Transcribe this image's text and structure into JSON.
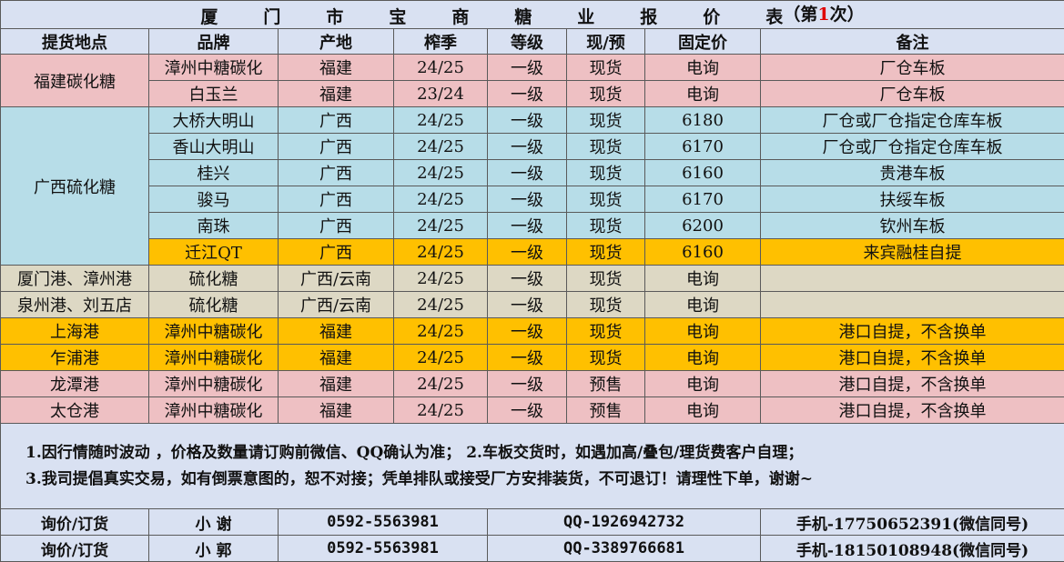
{
  "title": {
    "chars": [
      "厦",
      "门",
      "市",
      "宝",
      "商",
      "糖",
      "业",
      "报",
      "价",
      "表"
    ],
    "suffix_open": "（第",
    "suffix_num": "1",
    "suffix_close": "次）"
  },
  "headers": [
    "提货地点",
    "品牌",
    "产地",
    "榨季",
    "等级",
    "现/预",
    "固定价",
    "备注"
  ],
  "groups": {
    "fujian": "福建碳化糖",
    "guangxi": "广西硫化糖"
  },
  "rows": [
    {
      "location": "",
      "brand": "漳州中糖碳化",
      "origin": "福建",
      "season": "24/25",
      "grade": "一级",
      "status": "现货",
      "price": "电询",
      "note": "厂仓车板"
    },
    {
      "location": "",
      "brand": "白玉兰",
      "origin": "福建",
      "season": "23/24",
      "grade": "一级",
      "status": "现货",
      "price": "电询",
      "note": "厂仓车板"
    },
    {
      "location": "",
      "brand": "大桥大明山",
      "origin": "广西",
      "season": "24/25",
      "grade": "一级",
      "status": "现货",
      "price": "6180",
      "note": "厂仓或厂仓指定仓库车板"
    },
    {
      "location": "",
      "brand": "香山大明山",
      "origin": "广西",
      "season": "24/25",
      "grade": "一级",
      "status": "现货",
      "price": "6170",
      "note": "厂仓或厂仓指定仓库车板"
    },
    {
      "location": "",
      "brand": "桂兴",
      "origin": "广西",
      "season": "24/25",
      "grade": "一级",
      "status": "现货",
      "price": "6160",
      "note": "贵港车板"
    },
    {
      "location": "",
      "brand": "骏马",
      "origin": "广西",
      "season": "24/25",
      "grade": "一级",
      "status": "现货",
      "price": "6170",
      "note": "扶绥车板"
    },
    {
      "location": "",
      "brand": "南珠",
      "origin": "广西",
      "season": "24/25",
      "grade": "一级",
      "status": "现货",
      "price": "6200",
      "note": "钦州车板"
    },
    {
      "location": "",
      "brand": "迁江QT",
      "origin": "广西",
      "season": "24/25",
      "grade": "一级",
      "status": "现货",
      "price": "6160",
      "note": "来宾融桂自提"
    },
    {
      "location": "厦门港、漳州港",
      "brand": "硫化糖",
      "origin": "广西/云南",
      "season": "24/25",
      "grade": "一级",
      "status": "现货",
      "price": "电询",
      "note": ""
    },
    {
      "location": "泉州港、刘五店",
      "brand": "硫化糖",
      "origin": "广西/云南",
      "season": "24/25",
      "grade": "一级",
      "status": "现货",
      "price": "电询",
      "note": ""
    },
    {
      "location": "上海港",
      "brand": "漳州中糖碳化",
      "origin": "福建",
      "season": "24/25",
      "grade": "一级",
      "status": "现货",
      "price": "电询",
      "note": "港口自提，不含换单"
    },
    {
      "location": "乍浦港",
      "brand": "漳州中糖碳化",
      "origin": "福建",
      "season": "24/25",
      "grade": "一级",
      "status": "现货",
      "price": "电询",
      "note": "港口自提，不含换单"
    },
    {
      "location": "龙潭港",
      "brand": "漳州中糖碳化",
      "origin": "福建",
      "season": "24/25",
      "grade": "一级",
      "status": "预售",
      "price": "电询",
      "note": "港口自提，不含换单"
    },
    {
      "location": "太仓港",
      "brand": "漳州中糖碳化",
      "origin": "福建",
      "season": "24/25",
      "grade": "一级",
      "status": "预售",
      "price": "电询",
      "note": "港口自提，不含换单"
    }
  ],
  "notes": {
    "line1": "1.因行情随时波动 ，价格及数量请订购前微信、QQ确认为准；  2.车板交货时，如遇加高/叠包/理货费客户自理；",
    "line2": "3.我司提倡真实交易，如有倒票意图的，恕不对接；凭单排队或接受厂方安排装货，不可退订！请理性下单，谢谢~"
  },
  "contacts": [
    {
      "label": "询价/订货",
      "name": "小 谢",
      "phone": "0592-5563981",
      "qq": "QQ-1926942732",
      "mobile": "手机-17750652391(微信同号)"
    },
    {
      "label": "询价/订货",
      "name": "小 郭",
      "phone": "0592-5563981",
      "qq": "QQ-3389766681",
      "mobile": "手机-18150108948(微信同号)"
    }
  ],
  "colors": {
    "header_bg": "#d9e1f2",
    "fujian_bg": "#eec0c3",
    "guangxi_bg": "#b7dde8",
    "highlight_bg": "#ffc000",
    "port_bg": "#ddd8c4",
    "title_number": "#e00000"
  }
}
